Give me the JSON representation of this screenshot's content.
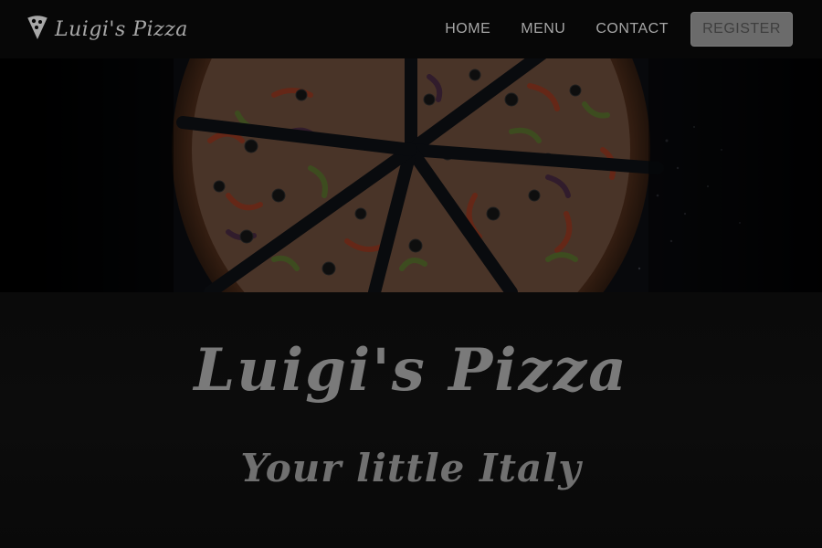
{
  "brand": {
    "name": "Luigi's Pizza",
    "icon": "pizza-slice-icon"
  },
  "nav": {
    "items": [
      {
        "label": "HOME"
      },
      {
        "label": "MENU"
      },
      {
        "label": "CONTACT"
      }
    ],
    "register_label": "REGISTER"
  },
  "hero": {
    "image": "pizza-photo",
    "title": "Luigi's Pizza",
    "subtitle": "Your little Italy"
  },
  "colors": {
    "background": "#0a0a0a",
    "nav_text": "#a6a6a6",
    "register_bg": "#6b6b6b",
    "title_text": "#7a7a7a"
  }
}
